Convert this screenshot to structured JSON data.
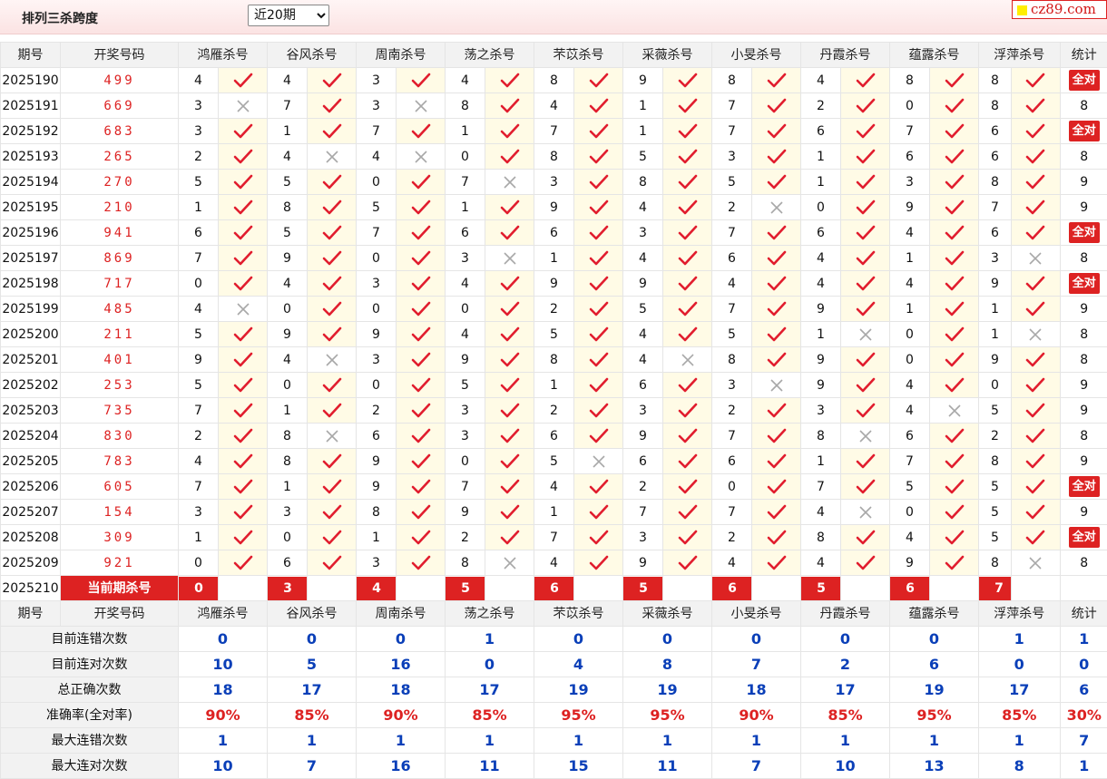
{
  "header": {
    "title": "排列三杀跨度",
    "period_select": "近20期",
    "logo": "cz89.com"
  },
  "columns": {
    "issue": "期号",
    "result": "开奖号码",
    "experts": [
      "鸿雁杀号",
      "谷风杀号",
      "周南杀号",
      "荡之杀号",
      "芣苡杀号",
      "采薇杀号",
      "小旻杀号",
      "丹霞杀号",
      "蕴露杀号",
      "浮萍杀号"
    ],
    "stat": "统计"
  },
  "full_label": "全对",
  "rows": [
    {
      "issue": "2025190",
      "result": "499",
      "kills": [
        4,
        4,
        3,
        4,
        8,
        9,
        8,
        4,
        8,
        8
      ],
      "ok": [
        1,
        1,
        1,
        1,
        1,
        1,
        1,
        1,
        1,
        1
      ],
      "stat": "全对"
    },
    {
      "issue": "2025191",
      "result": "669",
      "kills": [
        3,
        7,
        3,
        8,
        4,
        1,
        7,
        2,
        0,
        8
      ],
      "ok": [
        0,
        1,
        0,
        1,
        1,
        1,
        1,
        1,
        1,
        1
      ],
      "stat": "8"
    },
    {
      "issue": "2025192",
      "result": "683",
      "kills": [
        3,
        1,
        7,
        1,
        7,
        1,
        7,
        6,
        7,
        6
      ],
      "ok": [
        1,
        1,
        1,
        1,
        1,
        1,
        1,
        1,
        1,
        1
      ],
      "stat": "全对"
    },
    {
      "issue": "2025193",
      "result": "265",
      "kills": [
        2,
        4,
        4,
        0,
        8,
        5,
        3,
        1,
        6,
        6
      ],
      "ok": [
        1,
        0,
        0,
        1,
        1,
        1,
        1,
        1,
        1,
        1
      ],
      "stat": "8"
    },
    {
      "issue": "2025194",
      "result": "270",
      "kills": [
        5,
        5,
        0,
        7,
        3,
        8,
        5,
        1,
        3,
        8
      ],
      "ok": [
        1,
        1,
        1,
        0,
        1,
        1,
        1,
        1,
        1,
        1
      ],
      "stat": "9"
    },
    {
      "issue": "2025195",
      "result": "210",
      "kills": [
        1,
        8,
        5,
        1,
        9,
        4,
        2,
        0,
        9,
        7
      ],
      "ok": [
        1,
        1,
        1,
        1,
        1,
        1,
        0,
        1,
        1,
        1
      ],
      "stat": "9"
    },
    {
      "issue": "2025196",
      "result": "941",
      "kills": [
        6,
        5,
        7,
        6,
        6,
        3,
        7,
        6,
        4,
        6
      ],
      "ok": [
        1,
        1,
        1,
        1,
        1,
        1,
        1,
        1,
        1,
        1
      ],
      "stat": "全对"
    },
    {
      "issue": "2025197",
      "result": "869",
      "kills": [
        7,
        9,
        0,
        3,
        1,
        4,
        6,
        4,
        1,
        3
      ],
      "ok": [
        1,
        1,
        1,
        0,
        1,
        1,
        1,
        1,
        1,
        0
      ],
      "stat": "8"
    },
    {
      "issue": "2025198",
      "result": "717",
      "kills": [
        0,
        4,
        3,
        4,
        9,
        9,
        4,
        4,
        4,
        9
      ],
      "ok": [
        1,
        1,
        1,
        1,
        1,
        1,
        1,
        1,
        1,
        1
      ],
      "stat": "全对"
    },
    {
      "issue": "2025199",
      "result": "485",
      "kills": [
        4,
        0,
        0,
        0,
        2,
        5,
        7,
        9,
        1,
        1
      ],
      "ok": [
        0,
        1,
        1,
        1,
        1,
        1,
        1,
        1,
        1,
        1
      ],
      "stat": "9"
    },
    {
      "issue": "2025200",
      "result": "211",
      "kills": [
        5,
        9,
        9,
        4,
        5,
        4,
        5,
        1,
        0,
        1
      ],
      "ok": [
        1,
        1,
        1,
        1,
        1,
        1,
        1,
        0,
        1,
        0
      ],
      "stat": "8"
    },
    {
      "issue": "2025201",
      "result": "401",
      "kills": [
        9,
        4,
        3,
        9,
        8,
        4,
        8,
        9,
        0,
        9
      ],
      "ok": [
        1,
        0,
        1,
        1,
        1,
        0,
        1,
        1,
        1,
        1
      ],
      "stat": "8"
    },
    {
      "issue": "2025202",
      "result": "253",
      "kills": [
        5,
        0,
        0,
        5,
        1,
        6,
        3,
        9,
        4,
        0
      ],
      "ok": [
        1,
        1,
        1,
        1,
        1,
        1,
        0,
        1,
        1,
        1
      ],
      "stat": "9"
    },
    {
      "issue": "2025203",
      "result": "735",
      "kills": [
        7,
        1,
        2,
        3,
        2,
        3,
        2,
        3,
        4,
        5
      ],
      "ok": [
        1,
        1,
        1,
        1,
        1,
        1,
        1,
        1,
        0,
        1
      ],
      "stat": "9"
    },
    {
      "issue": "2025204",
      "result": "830",
      "kills": [
        2,
        8,
        6,
        3,
        6,
        9,
        7,
        8,
        6,
        2
      ],
      "ok": [
        1,
        0,
        1,
        1,
        1,
        1,
        1,
        0,
        1,
        1
      ],
      "stat": "8"
    },
    {
      "issue": "2025205",
      "result": "783",
      "kills": [
        4,
        8,
        9,
        0,
        5,
        6,
        6,
        1,
        7,
        8
      ],
      "ok": [
        1,
        1,
        1,
        1,
        0,
        1,
        1,
        1,
        1,
        1
      ],
      "stat": "9"
    },
    {
      "issue": "2025206",
      "result": "605",
      "kills": [
        7,
        1,
        9,
        7,
        4,
        2,
        0,
        7,
        5,
        5
      ],
      "ok": [
        1,
        1,
        1,
        1,
        1,
        1,
        1,
        1,
        1,
        1
      ],
      "stat": "全对"
    },
    {
      "issue": "2025207",
      "result": "154",
      "kills": [
        3,
        3,
        8,
        9,
        1,
        7,
        7,
        4,
        0,
        5
      ],
      "ok": [
        1,
        1,
        1,
        1,
        1,
        1,
        1,
        0,
        1,
        1
      ],
      "stat": "9"
    },
    {
      "issue": "2025208",
      "result": "309",
      "kills": [
        1,
        0,
        1,
        2,
        7,
        3,
        2,
        8,
        4,
        5
      ],
      "ok": [
        1,
        1,
        1,
        1,
        1,
        1,
        1,
        1,
        1,
        1
      ],
      "stat": "全对"
    },
    {
      "issue": "2025209",
      "result": "921",
      "kills": [
        0,
        6,
        3,
        8,
        4,
        9,
        4,
        4,
        9,
        8
      ],
      "ok": [
        1,
        1,
        1,
        0,
        1,
        1,
        1,
        1,
        1,
        0
      ],
      "stat": "8"
    }
  ],
  "current": {
    "issue": "2025210",
    "label": "当前期杀号",
    "kills": [
      0,
      3,
      4,
      5,
      6,
      5,
      6,
      5,
      6,
      7
    ]
  },
  "stats": [
    {
      "label": "目前连错次数",
      "values": [
        "0",
        "0",
        "0",
        "1",
        "0",
        "0",
        "0",
        "0",
        "0",
        "1"
      ],
      "stat": "1"
    },
    {
      "label": "目前连对次数",
      "values": [
        "10",
        "5",
        "16",
        "0",
        "4",
        "8",
        "7",
        "2",
        "6",
        "0"
      ],
      "stat": "0"
    },
    {
      "label": "总正确次数",
      "values": [
        "18",
        "17",
        "18",
        "17",
        "19",
        "19",
        "18",
        "17",
        "19",
        "17"
      ],
      "stat": "6"
    },
    {
      "label": "准确率(全对率)",
      "values": [
        "90%",
        "85%",
        "90%",
        "85%",
        "95%",
        "95%",
        "90%",
        "85%",
        "95%",
        "85%"
      ],
      "stat": "30%",
      "rate": true
    },
    {
      "label": "最大连错次数",
      "values": [
        "1",
        "1",
        "1",
        "1",
        "1",
        "1",
        "1",
        "1",
        "1",
        "1"
      ],
      "stat": "7"
    },
    {
      "label": "最大连对次数",
      "values": [
        "10",
        "7",
        "16",
        "11",
        "15",
        "11",
        "7",
        "10",
        "13",
        "8"
      ],
      "stat": "1"
    }
  ],
  "icons": {
    "ok": "check-icon",
    "no": "cross-icon"
  },
  "colors": {
    "accent": "#d22222",
    "stat_blue": "#0a3fb8",
    "header_bg": "#f2f2f2",
    "mark_bg": "#fffbe6"
  }
}
